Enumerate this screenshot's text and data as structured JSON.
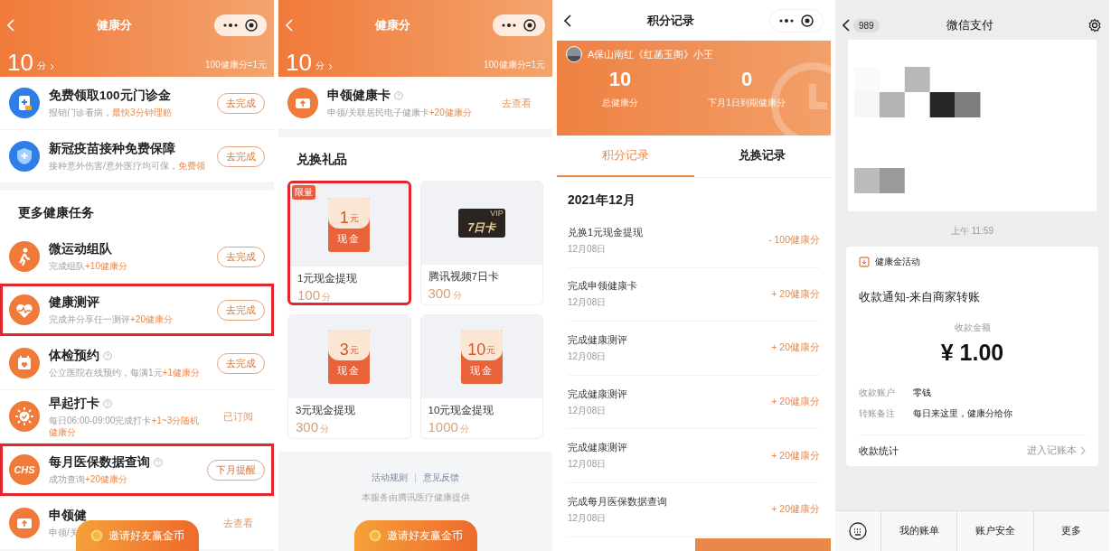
{
  "health_score_tasks": {
    "nav": {
      "title": "健康分"
    },
    "score": {
      "value": "10",
      "unit": "分",
      "rate": "100健康分=1元"
    },
    "top_tasks": [
      {
        "title": "免费领取100元门诊金",
        "help": false,
        "desc": "报销门诊看病，",
        "bonus": "最快3分钟理赔",
        "action": {
          "kind": "button",
          "label": "去完成"
        },
        "highlighted": false
      },
      {
        "title": "新冠疫苗接种免费保障",
        "help": false,
        "desc": "接种意外伤害/意外医疗均可保，",
        "bonus": "免费领",
        "action": {
          "kind": "button",
          "label": "去完成"
        },
        "highlighted": false
      }
    ],
    "section_title": "更多健康任务",
    "more_tasks": [
      {
        "title": "微运动组队",
        "help": false,
        "desc": "完成组队",
        "bonus": "+10健康分",
        "action": {
          "kind": "button",
          "label": "去完成"
        },
        "highlighted": false
      },
      {
        "title": "健康测评",
        "help": false,
        "desc": "完成并分享任一测评",
        "bonus": "+20健康分",
        "action": {
          "kind": "button",
          "label": "去完成"
        },
        "highlighted": true
      },
      {
        "title": "体检预约",
        "help": true,
        "desc": "公立医院在线预约，每满1元",
        "bonus": "+1健康分",
        "action": {
          "kind": "button",
          "label": "去完成"
        },
        "highlighted": false
      },
      {
        "title": "早起打卡",
        "help": true,
        "desc": "每日06:00-09:00完成打卡",
        "bonus": "+1~3分随机健康分",
        "action": {
          "kind": "status",
          "label": "已订阅"
        },
        "highlighted": false
      },
      {
        "title": "每月医保数据查询",
        "help": true,
        "desc": "成功查询",
        "bonus": "+20健康分",
        "logo_text": "CHS",
        "action": {
          "kind": "button",
          "label": "下月提醒"
        },
        "highlighted": true
      },
      {
        "title": "申领健",
        "help": false,
        "desc": "申领/关",
        "action": {
          "kind": "status",
          "label": "去查看"
        },
        "highlighted": false
      }
    ],
    "invite_button": "邀请好友赢金币"
  },
  "health_score_gifts": {
    "nav": {
      "title": "健康分"
    },
    "score": {
      "value": "10",
      "unit": "分",
      "rate": "100健康分=1元"
    },
    "task": {
      "title": "申领健康卡",
      "help": true,
      "desc": "申领/关联居民电子健康卡",
      "bonus": "+20健康分",
      "action": {
        "kind": "status",
        "label": "去查看"
      },
      "highlighted": false
    },
    "section_title": "兑换礼品",
    "gifts": [
      {
        "kind": "cash",
        "tag": "限量",
        "amount": "1",
        "currency": "元",
        "label": "现金",
        "title": "1元现金提现",
        "points": "100",
        "unit": "分",
        "highlighted": true
      },
      {
        "kind": "vip",
        "badge": "VIP",
        "days": "7日卡",
        "title": "腾讯视频7日卡",
        "points": "300",
        "unit": "分",
        "highlighted": false
      },
      {
        "kind": "cash",
        "amount": "3",
        "currency": "元",
        "label": "现金",
        "title": "3元现金提现",
        "points": "300",
        "unit": "分",
        "highlighted": false
      },
      {
        "kind": "cash",
        "amount": "10",
        "currency": "元",
        "label": "现金",
        "title": "10元现金提现",
        "points": "1000",
        "unit": "分",
        "highlighted": false
      }
    ],
    "footer_links": [
      "活动规则",
      "意见反馈"
    ],
    "provider": "本服务由腾讯医疗健康提供",
    "invite_button": "邀请好友赢金币"
  },
  "points_record": {
    "nav": {
      "title": "积分记录"
    },
    "profile": {
      "name": "A保山南红《红菡玉阁》小王"
    },
    "stats": [
      {
        "value": "10",
        "label": "总健康分"
      },
      {
        "value": "0",
        "label": "下月1日到期健康分"
      }
    ],
    "tabs": [
      {
        "label": "积分记录",
        "selected": true
      },
      {
        "label": "兑换记录",
        "selected": false
      }
    ],
    "month": "2021年12月",
    "records": [
      {
        "title": "兑换1元现金提现",
        "date": "12月08日",
        "amount": "- 100健康分"
      },
      {
        "title": "完成申领健康卡",
        "date": "12月08日",
        "amount": "+ 20健康分"
      },
      {
        "title": "完成健康测评",
        "date": "12月08日",
        "amount": "+ 20健康分"
      },
      {
        "title": "完成健康测评",
        "date": "12月08日",
        "amount": "+ 20健康分"
      },
      {
        "title": "完成健康测评",
        "date": "12月08日",
        "amount": "+ 20健康分"
      },
      {
        "title": "完成每月医保数据查询",
        "date": "12月08日",
        "amount": "+ 20健康分"
      }
    ]
  },
  "wechat_pay": {
    "nav": {
      "badge": "989",
      "title": "微信支付"
    },
    "time": "上午 11:59",
    "card": {
      "source": "健康金活动",
      "heading": "收款通知-来自商家转账",
      "amount_label": "收款金额",
      "amount": "¥ 1.00",
      "details": [
        {
          "label": "收款账户",
          "value": "零钱"
        },
        {
          "label": "转账备注",
          "value": "每日来这里，健康分给你"
        }
      ],
      "footer_label": "收款统计",
      "footer_link": "进入记账本"
    },
    "menu": [
      "我的账单",
      "账户安全",
      "更多"
    ]
  }
}
